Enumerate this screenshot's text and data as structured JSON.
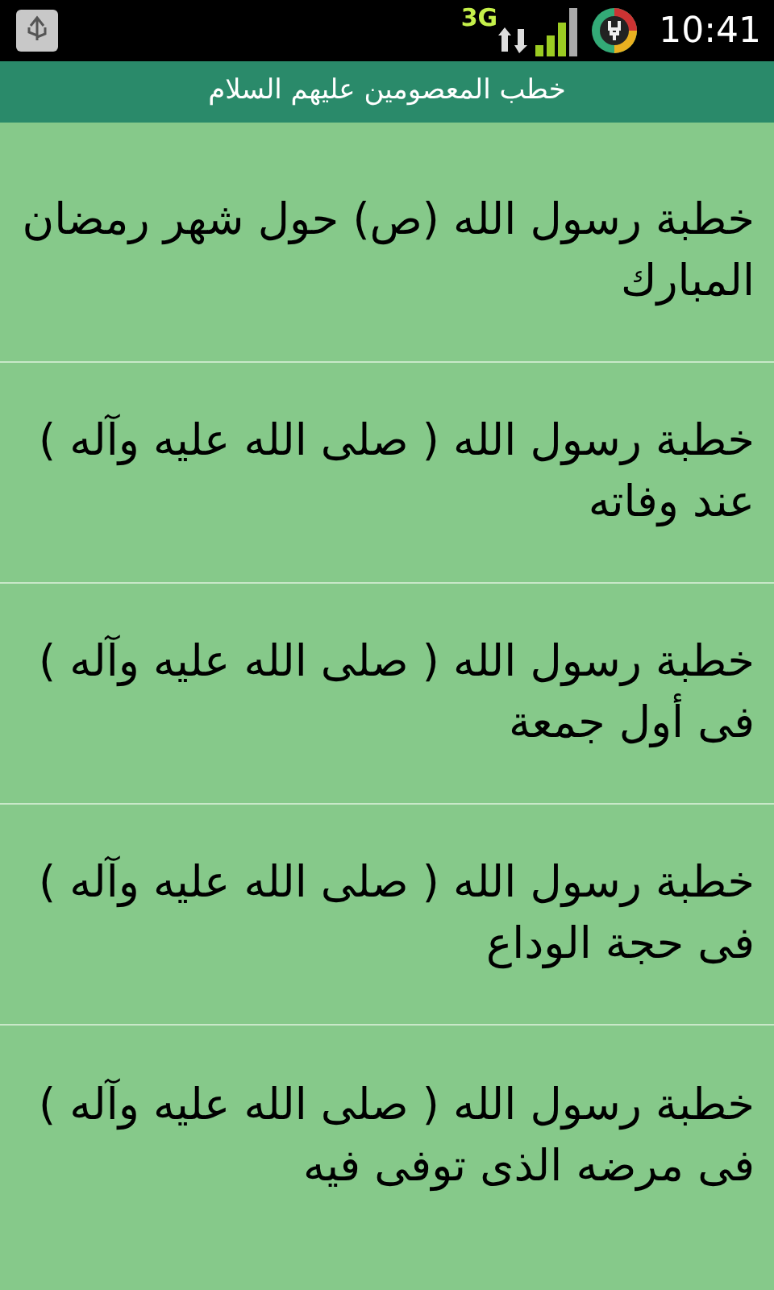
{
  "status_bar": {
    "network": "3G",
    "time": "10:41"
  },
  "title": "خطب المعصومين عليهم السلام",
  "items": [
    {
      "label": "خطبة رسول الله (ص) حول شهر رمضان المبارك"
    },
    {
      "label": "خطبة رسول الله ( صلى الله عليه وآله ) عند وفاته"
    },
    {
      "label": "خطبة رسول الله ( صلى الله عليه وآله ) فى أول جمعة"
    },
    {
      "label": "خطبة رسول الله ( صلى الله عليه وآله ) فى حجة الوداع"
    },
    {
      "label": "خطبة رسول الله ( صلى الله عليه وآله ) فى مرضه الذى توفى فيه"
    }
  ]
}
